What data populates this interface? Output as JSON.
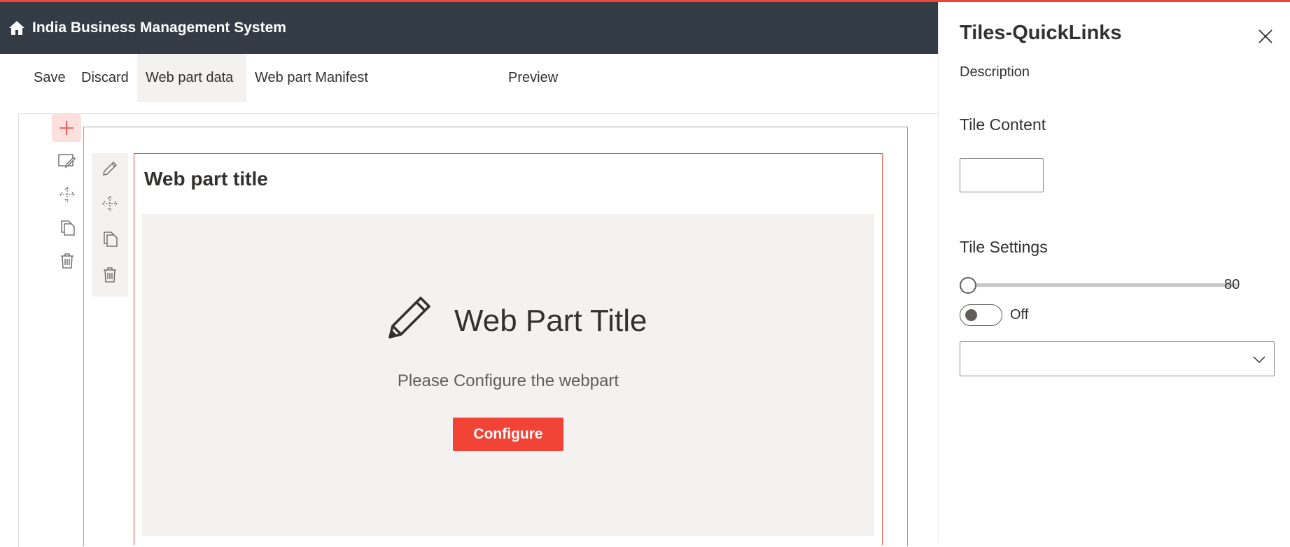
{
  "app": {
    "title": "India Business Management System",
    "accent_color": "#f14336",
    "header_color": "#333c44"
  },
  "toolbar": {
    "save_label": "Save",
    "discard_label": "Discard",
    "webpart_data_label": "Web part data",
    "webpart_manifest_label": "Web part Manifest",
    "preview_label": "Preview",
    "active_tab": "Web part data"
  },
  "section_tools": {
    "icons": [
      "plus-icon",
      "edit-section-icon",
      "move-icon",
      "duplicate-icon",
      "delete-icon"
    ]
  },
  "webpart_tools": {
    "icons": [
      "pencil-icon",
      "move-icon",
      "duplicate-icon",
      "delete-icon"
    ]
  },
  "webpart": {
    "title": "Web part title",
    "placeholder": {
      "icon": "pencil-icon",
      "title": "Web Part Title",
      "description": "Please Configure the webpart",
      "button_label": "Configure"
    }
  },
  "panel": {
    "title": "Tiles-QuickLinks",
    "description_label": "Description",
    "tile_content_label": "Tile Content",
    "tile_content_value": "",
    "tile_settings_label": "Tile Settings",
    "slider_value": "80",
    "toggle_state": "Off",
    "dropdown_value": ""
  }
}
